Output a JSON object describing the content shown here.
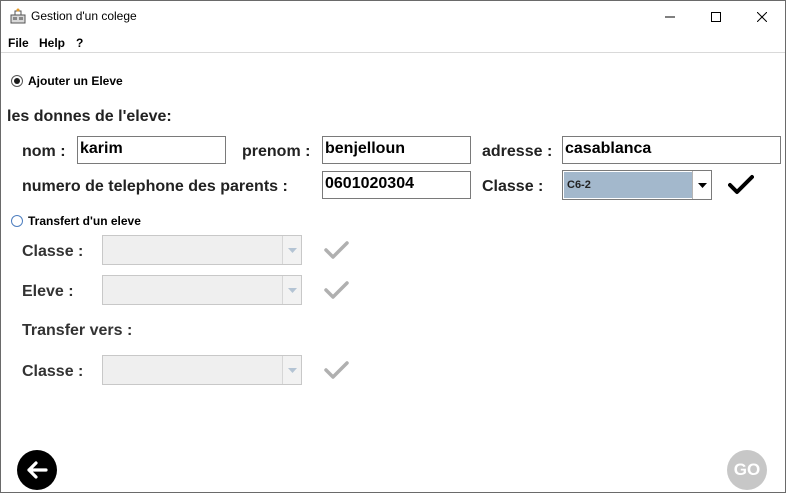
{
  "window": {
    "title": "Gestion d'un colege"
  },
  "menu": {
    "file": "File",
    "help": "Help",
    "question": "?"
  },
  "add_section": {
    "radio_label": "Ajouter un Eleve",
    "selected": true,
    "heading": "les donnes de l'eleve:",
    "nom_label": "nom :",
    "nom_value": "karim",
    "prenom_label": "prenom :",
    "prenom_value": "benjelloun",
    "adresse_label": "adresse :",
    "adresse_value": "casablanca",
    "phone_label": "numero de telephone des parents :",
    "phone_value": "0601020304",
    "classe_label": "Classe :",
    "classe_value": "C6-2"
  },
  "transfer_section": {
    "radio_label": "Transfert d'un eleve",
    "selected": false,
    "classe_label": "Classe :",
    "eleve_label": "Eleve :",
    "transfer_vers_label": "Transfer vers :",
    "classe2_label": "Classe :"
  },
  "buttons": {
    "go": "GO"
  },
  "colors": {
    "selected_combo": "#a3b8cc",
    "disabled_check": "#b0b0b0",
    "go_button": "#c7c7c7"
  }
}
